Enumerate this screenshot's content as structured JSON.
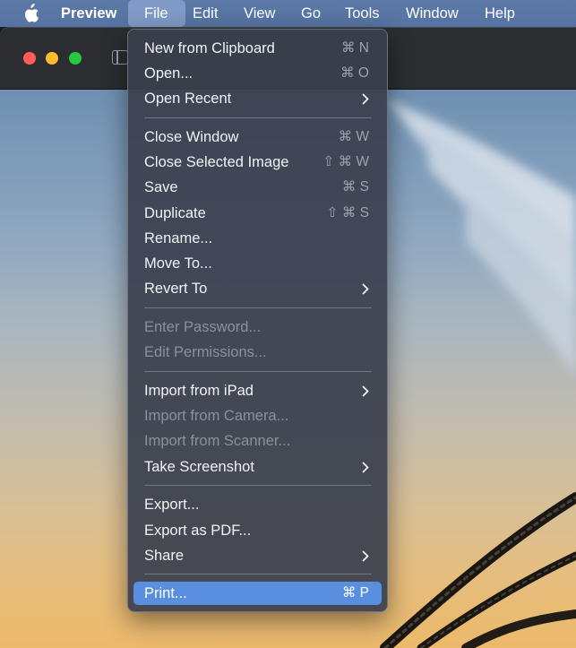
{
  "menubar": {
    "app_name": "Preview",
    "menus": [
      "File",
      "Edit",
      "View",
      "Go",
      "Tools",
      "Window",
      "Help"
    ],
    "active_menu": "File"
  },
  "icons": {
    "apple": "apple-logo-icon",
    "sidebar": "sidebar-toggle-icon",
    "submenu": "chevron-right-icon"
  },
  "colors": {
    "menubar": "#5674a3",
    "active_menu": "#7f9ac6",
    "highlight": "#5a8fe0",
    "close": "#ff5f57",
    "minimize": "#febc2e",
    "zoom": "#28c840"
  },
  "file_menu": {
    "new_from_clipboard": {
      "label": "New from Clipboard",
      "shortcut": "⌘ N"
    },
    "open": {
      "label": "Open...",
      "shortcut": "⌘ O"
    },
    "open_recent": {
      "label": "Open Recent"
    },
    "close_window": {
      "label": "Close Window",
      "shortcut": "⌘ W"
    },
    "close_selected_image": {
      "label": "Close Selected Image",
      "shortcut": "⇧ ⌘ W"
    },
    "save": {
      "label": "Save",
      "shortcut": "⌘ S"
    },
    "duplicate": {
      "label": "Duplicate",
      "shortcut": "⇧ ⌘ S"
    },
    "rename": {
      "label": "Rename..."
    },
    "move_to": {
      "label": "Move To..."
    },
    "revert_to": {
      "label": "Revert To"
    },
    "enter_password": {
      "label": "Enter Password..."
    },
    "edit_permissions": {
      "label": "Edit Permissions..."
    },
    "import_from_ipad": {
      "label": "Import from iPad"
    },
    "import_from_camera": {
      "label": "Import from Camera..."
    },
    "import_from_scanner": {
      "label": "Import from Scanner..."
    },
    "take_screenshot": {
      "label": "Take Screenshot"
    },
    "export": {
      "label": "Export..."
    },
    "export_as_pdf": {
      "label": "Export as PDF..."
    },
    "share": {
      "label": "Share"
    },
    "print": {
      "label": "Print...",
      "shortcut": "⌘ P"
    }
  }
}
